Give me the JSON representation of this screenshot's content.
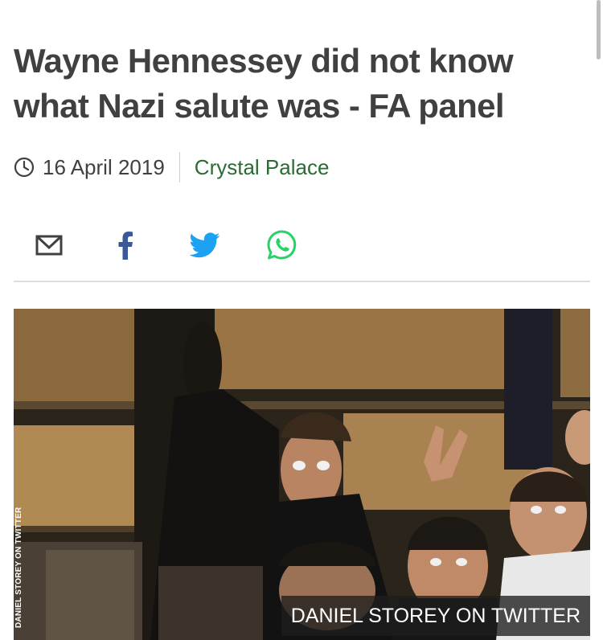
{
  "article": {
    "headline": "Wayne Hennessey did not know what Nazi salute was - FA panel",
    "date": "16 April 2019",
    "topic": "Crystal Palace"
  },
  "share": {
    "email": "email-icon",
    "facebook": "facebook-icon",
    "twitter": "twitter-icon",
    "whatsapp": "whatsapp-icon"
  },
  "image": {
    "vertical_credit": "DANIEL STOREY ON TWITTER",
    "caption": "DANIEL STOREY ON TWITTER"
  },
  "colors": {
    "headline": "#404040",
    "topic": "#2b6b34",
    "facebook": "#3b5998",
    "twitter": "#1da1f2",
    "whatsapp": "#25d366"
  }
}
